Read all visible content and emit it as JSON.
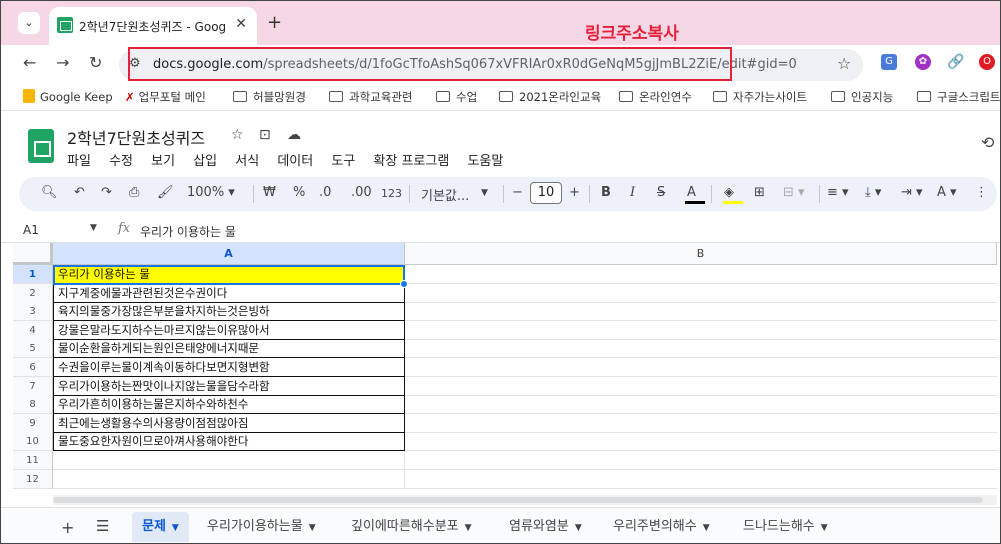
{
  "browser": {
    "tab_title": "2학년7단원초성퀴즈 - Google",
    "url_host": "docs.google.com",
    "url_path": "/spreadsheets/d/1foGcTfoAshSq067xVFRIAr0xR0dGeNqM5gjJmBL2ZiE/edit#gid=0",
    "annotation": "링크주소복사",
    "bookmarks": [
      "Google Keep",
      "업무포털 메인",
      "허블망원경",
      "과학교육관련",
      "수업",
      "2021온라인교육",
      "온라인연수",
      "자주가는사이트",
      "인공지능",
      "구글스크립트"
    ]
  },
  "doc": {
    "title": "2학년7단원초성퀴즈",
    "menu": [
      "파일",
      "수정",
      "보기",
      "삽입",
      "서식",
      "데이터",
      "도구",
      "확장 프로그램",
      "도움말"
    ]
  },
  "toolbar": {
    "zoom": "100%",
    "currency": "₩",
    "percent": "%",
    "dec_decrease": ".0",
    "dec_increase": ".00",
    "format_123": "123",
    "font": "기본값...",
    "font_size": "10"
  },
  "formula_bar": {
    "cell_ref": "A1",
    "content": "우리가 이용하는 물"
  },
  "sheet": {
    "columns": [
      "A",
      "B"
    ],
    "rows": [
      {
        "num": "1",
        "a": "우리가 이용하는 물"
      },
      {
        "num": "2",
        "a": "지구계중에물과관련된것은수권이다"
      },
      {
        "num": "3",
        "a": "육지의물중가장많은부분을차지하는것은빙하"
      },
      {
        "num": "4",
        "a": "강물은말라도지하수는마르지않는이유많아서"
      },
      {
        "num": "5",
        "a": "물이순환을하게되는원인은태양에너지때문"
      },
      {
        "num": "6",
        "a": "수권을이루는물이계속이동하다보면지형변함"
      },
      {
        "num": "7",
        "a": "우리가이용하는짠맛이나지않는물을담수라함"
      },
      {
        "num": "8",
        "a": "우리가흔히이용하는물은지하수와하천수"
      },
      {
        "num": "9",
        "a": "최근에는생활용수의사용량이점점많아짐"
      },
      {
        "num": "10",
        "a": "물도중요한자원이므로아껴사용해야한다"
      },
      {
        "num": "11",
        "a": ""
      },
      {
        "num": "12",
        "a": ""
      }
    ]
  },
  "sheet_tabs": [
    "문제",
    "우리가이용하는물",
    "깊이에따른해수분포",
    "염류와염분",
    "우리주변의해수",
    "드나드는해수"
  ],
  "colors": {
    "accent": "#0b57d0",
    "highlight_cell": "#ffff00",
    "annotation_red": "#e6213b",
    "sheets_green": "#1fa463"
  }
}
